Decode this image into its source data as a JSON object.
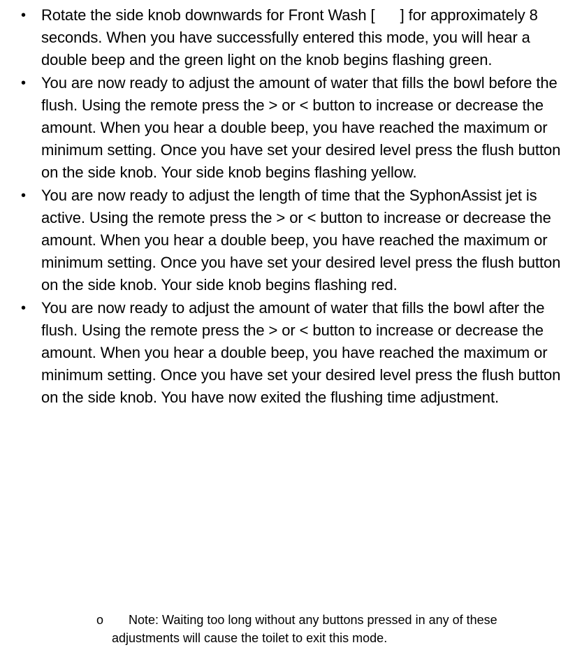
{
  "bullets": [
    {
      "marker": "•",
      "text": "Rotate the side knob downwards for Front Wash [      ] for approximately 8 seconds. When you have successfully entered this mode, you will hear a double beep and the green light on the knob begins flashing green."
    },
    {
      "marker": "•",
      "text": "You are now ready to adjust the amount of water that fills the bowl before the flush. Using the remote press the > or < button to increase or decrease the amount. When you hear a double beep, you have reached the maximum or minimum setting. Once you have set your desired level press the flush button on the side knob. Your side knob begins flashing yellow."
    },
    {
      "marker": "•",
      "text": "You are now ready to adjust the length of time that the SyphonAssist jet is active. Using the remote press the > or < button to increase or decrease the amount. When you hear a double beep, you have reached the maximum or minimum setting. Once you have set your desired level press the flush button on the side knob. Your side knob begins flashing red."
    },
    {
      "marker": "•",
      "text": "You are now ready to adjust the amount of water that fills the bowl after the flush. Using the remote press the > or < button to increase or decrease the amount. When you hear a double beep, you have reached the maximum or minimum setting. Once you have set your desired level press the flush button on the side knob. You have now exited the flushing time adjustment."
    }
  ],
  "note": {
    "marker": "o",
    "text": "Note: Waiting too long without any buttons pressed in any of these adjustments will cause the toilet to exit this mode."
  }
}
